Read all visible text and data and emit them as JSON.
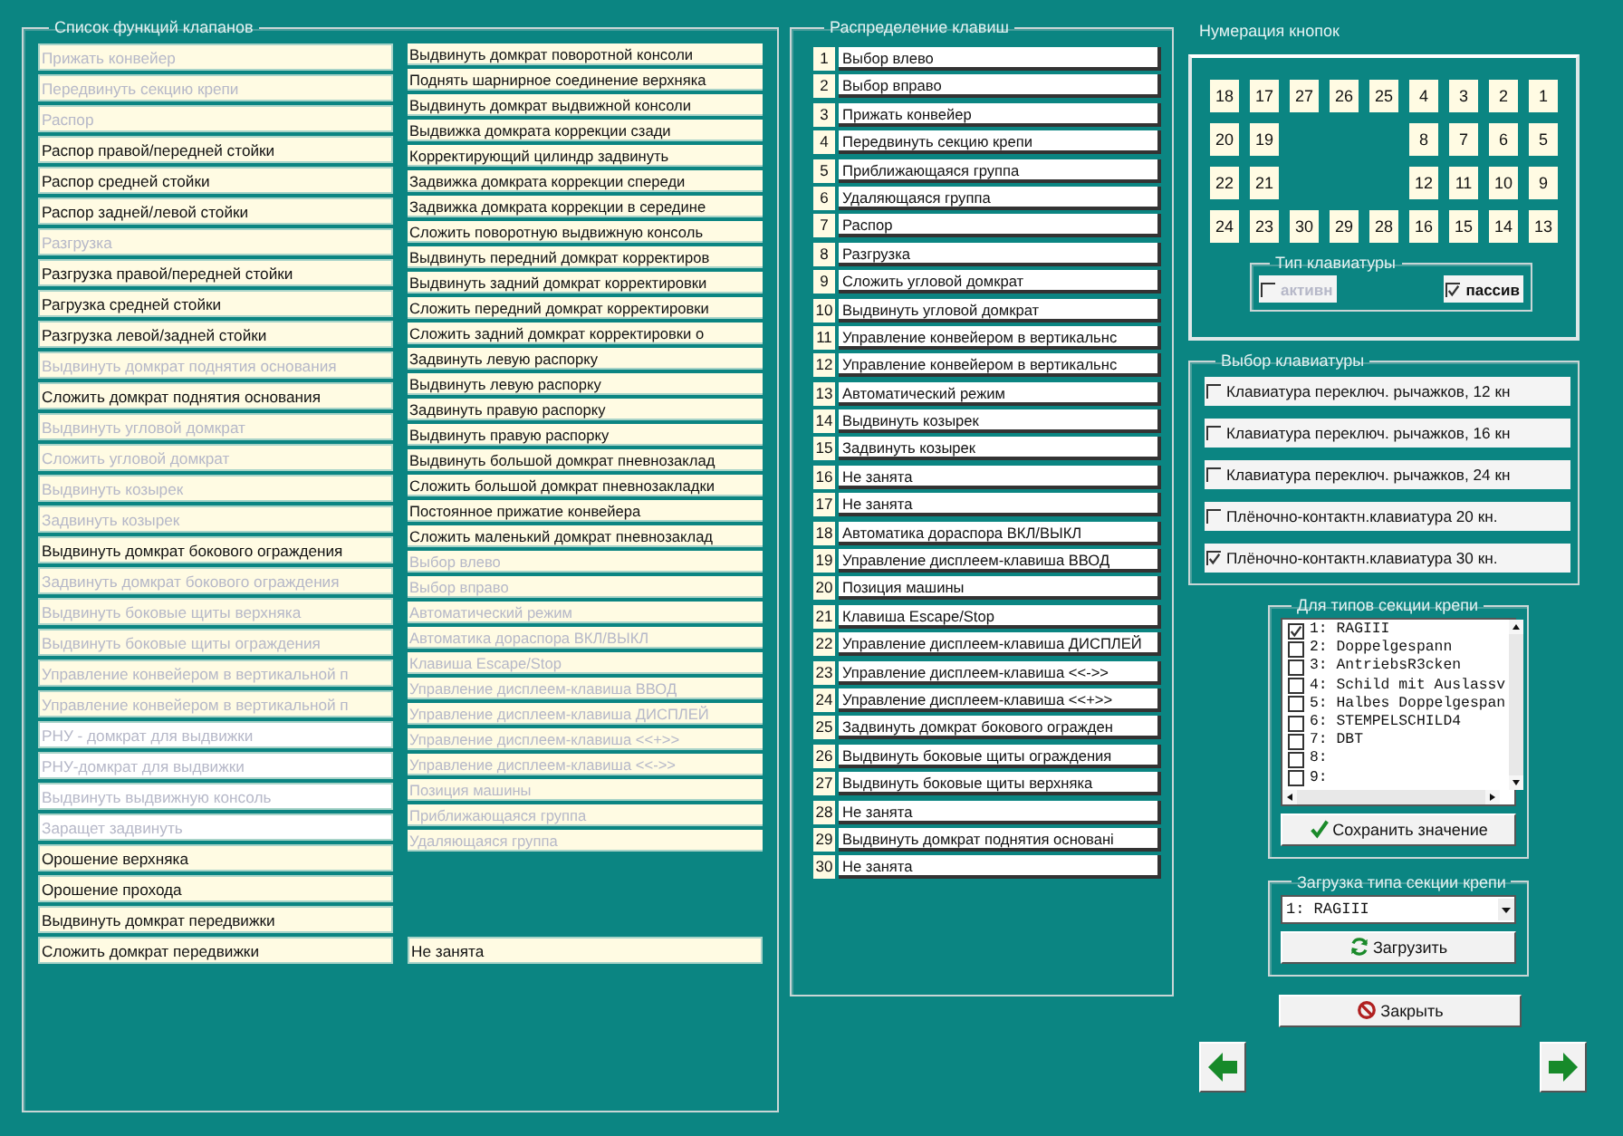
{
  "functions_list": {
    "title": "Список функций клапанов",
    "column_1": [
      {
        "label": "Прижать конвейер",
        "disabled": true,
        "marked": false
      },
      {
        "label": "Передвинуть секцию крепи",
        "disabled": true,
        "marked": false
      },
      {
        "label": "Распор",
        "disabled": true,
        "marked": false
      },
      {
        "label": "Распор правой/передней стойки",
        "disabled": false,
        "marked": false
      },
      {
        "label": "Распор средней стойки",
        "disabled": false,
        "marked": false
      },
      {
        "label": "Распор задней/левой стойки",
        "disabled": false,
        "marked": false
      },
      {
        "label": "Разгрузка",
        "disabled": true,
        "marked": false
      },
      {
        "label": "Разгрузка  правой/передней стойки",
        "disabled": false,
        "marked": false
      },
      {
        "label": "Рагрузка средней стойки",
        "disabled": false,
        "marked": false
      },
      {
        "label": "Разгрузка левой/задней стойки",
        "disabled": false,
        "marked": false
      },
      {
        "label": "Выдвинуть домкрат поднятия основания",
        "disabled": true,
        "marked": false
      },
      {
        "label": "Сложить домкрат поднятия основания",
        "disabled": false,
        "marked": false
      },
      {
        "label": "Выдвинуть угловой домкрат",
        "disabled": true,
        "marked": false
      },
      {
        "label": "Сложить угловой домкрат",
        "disabled": true,
        "marked": false
      },
      {
        "label": "Выдвинуть козырек",
        "disabled": true,
        "marked": false
      },
      {
        "label": "Задвинуть козырек",
        "disabled": true,
        "marked": false
      },
      {
        "label": "Выдвинуть домкрат бокового ограждения",
        "disabled": false,
        "marked": false
      },
      {
        "label": "Задвинуть домкрат бокового ограждения",
        "disabled": true,
        "marked": false
      },
      {
        "label": "Выдвинуть боковые щиты верхняка",
        "disabled": true,
        "marked": false
      },
      {
        "label": "Выдвинуть боковые щиты ограждения",
        "disabled": true,
        "marked": false
      },
      {
        "label": "Управление конвейером в вертикальной п",
        "disabled": true,
        "marked": false
      },
      {
        "label": "Управление конвейером в вертикальной п",
        "disabled": true,
        "marked": false
      },
      {
        "label": "РНУ - домкрат для выдвижки",
        "disabled": true,
        "marked": true
      },
      {
        "label": "РНУ-домкрат для выдвижки",
        "disabled": true,
        "marked": true
      },
      {
        "label": "Выдвинуть выдвижную консоль",
        "disabled": true,
        "marked": true
      },
      {
        "label": "Заращет задвинуть",
        "disabled": true,
        "marked": true
      },
      {
        "label": "Орошение верхняка",
        "disabled": false,
        "marked": false
      },
      {
        "label": "Орошение прохода",
        "disabled": false,
        "marked": false
      },
      {
        "label": "Выдвинуть домкрат передвижки",
        "disabled": false,
        "marked": false
      },
      {
        "label": "Сложить домкрат передвижки",
        "disabled": false,
        "marked": false
      }
    ],
    "column_2": [
      {
        "label": "Выдвинуть домкрат поворотной консоли",
        "disabled": false
      },
      {
        "label": "Поднять шарнирное соединение верхняка",
        "disabled": false
      },
      {
        "label": "Выдвинуть домкрат выдвижной консоли",
        "disabled": false
      },
      {
        "label": "Выдвижка домкрата коррекции сзади",
        "disabled": false
      },
      {
        "label": "Корректирующий цилиндр задвинуть",
        "disabled": false
      },
      {
        "label": "Задвижка домкрата коррекции спереди",
        "disabled": false
      },
      {
        "label": "Задвижка домкрата коррекции в середине",
        "disabled": false
      },
      {
        "label": "Сложить поворотную выдвижную консоль",
        "disabled": false
      },
      {
        "label": "Выдвинуть передний домкрат корректиров",
        "disabled": false
      },
      {
        "label": "Выдвинуть задний домкрат корректировки",
        "disabled": false
      },
      {
        "label": "Сложить передний домкрат корректировки",
        "disabled": false
      },
      {
        "label": "Сложить задний домкрат корректировки о",
        "disabled": false
      },
      {
        "label": "Задвинуть левую распорку",
        "disabled": false
      },
      {
        "label": "Выдвинуть левую распорку",
        "disabled": false
      },
      {
        "label": "Задвинуть правую распорку",
        "disabled": false
      },
      {
        "label": "Выдвинуть правую распорку",
        "disabled": false
      },
      {
        "label": "Выдвинуть большой домкрат пневнозаклад",
        "disabled": false
      },
      {
        "label": "Сложить большой домкрат пневнозакладки",
        "disabled": false
      },
      {
        "label": "Постоянное прижатие конвейера",
        "disabled": false
      },
      {
        "label": "Сложить маленький домкрат пневнозаклад",
        "disabled": false
      },
      {
        "label": "Выбор влево",
        "disabled": true
      },
      {
        "label": "Выбор вправо",
        "disabled": true
      },
      {
        "label": "Автоматический режим",
        "disabled": true
      },
      {
        "label": "Автоматика дораспора ВКЛ/ВЫКЛ",
        "disabled": true
      },
      {
        "label": "Клавиша Escape/Stop",
        "disabled": true
      },
      {
        "label": "Управление дисплеем-клавиша ВВОД",
        "disabled": true
      },
      {
        "label": "Управление дисплеем-клавиша ДИСПЛЕЙ",
        "disabled": true
      },
      {
        "label": "Управление дисплеем-клавиша <<+>>",
        "disabled": true
      },
      {
        "label": "Управление дисплеем-клавиша <<->>",
        "disabled": true
      },
      {
        "label": "Позиция машины",
        "disabled": true
      },
      {
        "label": "Приближающаяся группа",
        "disabled": true
      },
      {
        "label": "Удаляющаяся группа",
        "disabled": true
      }
    ],
    "spare_item": "Не занята"
  },
  "key_assignment": {
    "title": "Распределение клавиш",
    "keys": [
      {
        "number": "1",
        "label": "Выбор влево"
      },
      {
        "number": "2",
        "label": "Выбор вправо"
      },
      {
        "number": "3",
        "label": "Прижать конвейер"
      },
      {
        "number": "4",
        "label": "Передвинуть секцию крепи"
      },
      {
        "number": "5",
        "label": "Приближающаяся группа"
      },
      {
        "number": "6",
        "label": "Удаляющаяся группа"
      },
      {
        "number": "7",
        "label": "Распор"
      },
      {
        "number": "8",
        "label": "Разгрузка"
      },
      {
        "number": "9",
        "label": "Сложить угловой домкрат"
      },
      {
        "number": "10",
        "label": "Выдвинуть угловой домкрат"
      },
      {
        "number": "11",
        "label": "Управление конвейером в вертикальнс"
      },
      {
        "number": "12",
        "label": "Управление конвейером в вертикальнс"
      },
      {
        "number": "13",
        "label": "Автоматический режим"
      },
      {
        "number": "14",
        "label": "Выдвинуть козырек"
      },
      {
        "number": "15",
        "label": "Задвинуть козырек"
      },
      {
        "number": "16",
        "label": "Не занята"
      },
      {
        "number": "17",
        "label": "Не занята"
      },
      {
        "number": "18",
        "label": "Автоматика дораспора ВКЛ/ВЫКЛ"
      },
      {
        "number": "19",
        "label": "Управление дисплеем-клавиша ВВОД"
      },
      {
        "number": "20",
        "label": "Позиция машины"
      },
      {
        "number": "21",
        "label": "Клавиша Escape/Stop"
      },
      {
        "number": "22",
        "label": "Управление дисплеем-клавиша ДИСПЛЕЙ"
      },
      {
        "number": "23",
        "label": "Управление дисплеем-клавиша <<->>"
      },
      {
        "number": "24",
        "label": "Управление дисплеем-клавиша <<+>>"
      },
      {
        "number": "25",
        "label": "Задвинуть домкрат бокового огражден"
      },
      {
        "number": "26",
        "label": "Выдвинуть боковые щиты ограждения"
      },
      {
        "number": "27",
        "label": "Выдвинуть боковые щиты верхняка"
      },
      {
        "number": "28",
        "label": "Не занята"
      },
      {
        "number": "29",
        "label": "Выдвинуть домкрат поднятия основані"
      },
      {
        "number": "30",
        "label": "Не занята"
      }
    ]
  },
  "button_numbering": {
    "title": "Нумерация кнопок",
    "rows": [
      [
        "18",
        "17",
        "27",
        "26",
        "25",
        "4",
        "3",
        "2",
        "1"
      ],
      [
        "20",
        "19",
        null,
        null,
        null,
        "8",
        "7",
        "6",
        "5"
      ],
      [
        "22",
        "21",
        null,
        null,
        null,
        "12",
        "11",
        "10",
        "9"
      ],
      [
        "24",
        "23",
        "30",
        "29",
        "28",
        "16",
        "15",
        "14",
        "13"
      ]
    ],
    "keyboard_type": {
      "title": "Тип клавиатуры",
      "options": [
        {
          "label": "активн",
          "checked": false,
          "disabled": true
        },
        {
          "label": "пассив",
          "checked": true,
          "disabled": false
        }
      ]
    }
  },
  "keyboard_choice": {
    "title": "Выбор клавиатуры",
    "options": [
      {
        "label": "Клавиатура переключ. рычажков, 12 кн",
        "checked": false
      },
      {
        "label": "Клавиатура переключ. рычажков, 16 кн",
        "checked": false
      },
      {
        "label": "Клавиатура переключ. рычажков, 24 кн",
        "checked": false
      },
      {
        "label": "Плёночно-контактн.клавиатура 20 кн.",
        "checked": false
      },
      {
        "label": "Плёночно-контактн.клавиатура 30 кн.",
        "checked": true
      }
    ]
  },
  "section_types": {
    "title": "Для типов секции крепи",
    "items": [
      {
        "label": "1: RAGIII",
        "checked": true
      },
      {
        "label": "2: Doppelgespann",
        "checked": false
      },
      {
        "label": "3: AntriebsR3cken",
        "checked": false
      },
      {
        "label": "4: Schild mit Auslassv",
        "checked": false
      },
      {
        "label": "5: Halbes Doppelgespan",
        "checked": false
      },
      {
        "label": "6: STEMPELSCHILD4",
        "checked": false
      },
      {
        "label": "7: DBT",
        "checked": false
      },
      {
        "label": "8:",
        "checked": false
      },
      {
        "label": "9:",
        "checked": false
      }
    ],
    "save_button": "Сохранить значение"
  },
  "load_section_type": {
    "title": "Загрузка типа секции крепи",
    "value": "1: RAGIII",
    "load_button": "Загрузить"
  },
  "close_button": "Закрыть"
}
